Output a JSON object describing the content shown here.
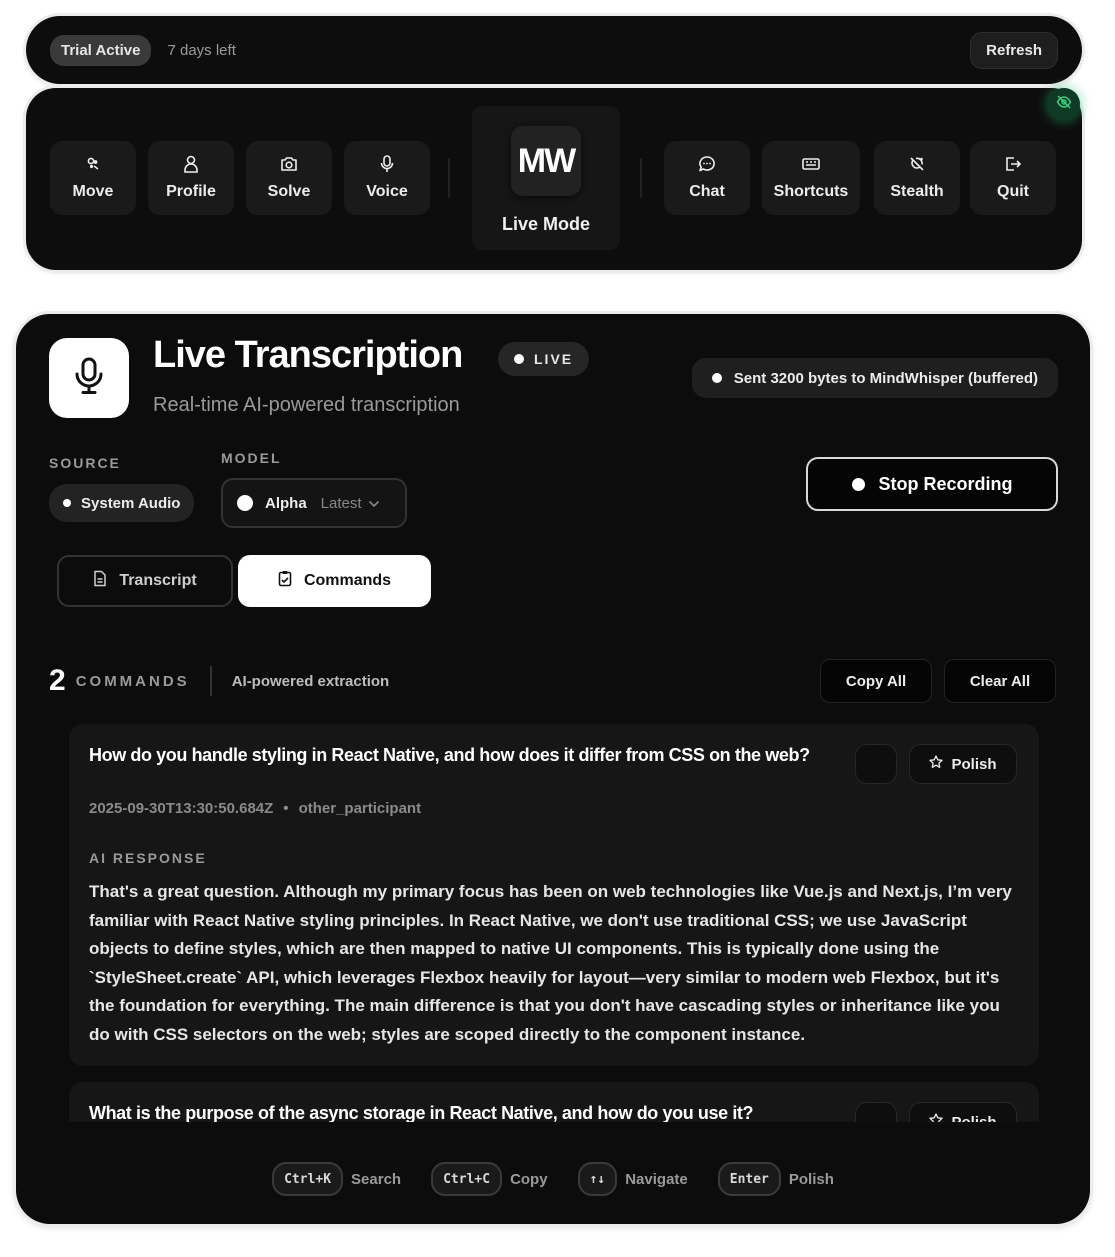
{
  "trial_bar": {
    "status_label": "Trial Active",
    "days_left": "7 days left",
    "refresh_label": "Refresh"
  },
  "toolbar": {
    "left_items": [
      {
        "label": "Move",
        "icon": "move-icon"
      },
      {
        "label": "Profile",
        "icon": "user-icon"
      },
      {
        "label": "Solve",
        "icon": "camera-icon"
      },
      {
        "label": "Voice",
        "icon": "microphone-icon"
      }
    ],
    "live_mode": {
      "logo_text": "MW",
      "label": "Live Mode"
    },
    "right_items": [
      {
        "label": "Chat",
        "icon": "chat-icon"
      },
      {
        "label": "Shortcuts",
        "icon": "keyboard-icon"
      },
      {
        "label": "Stealth",
        "icon": "stealth-icon"
      },
      {
        "label": "Quit",
        "icon": "logout-icon"
      }
    ],
    "stealth_indicator_icon": "eye-off-icon"
  },
  "panel": {
    "title": "Live Transcription",
    "live_badge": "LIVE",
    "subtitle": "Real-time AI-powered transcription",
    "status": "Sent 3200 bytes to MindWhisper (buffered)",
    "source": {
      "label": "SOURCE",
      "value": "System Audio"
    },
    "model": {
      "label": "MODEL",
      "name": "Alpha",
      "tag": "Latest"
    },
    "stop_button": "Stop Recording",
    "tabs": [
      {
        "label": "Transcript",
        "icon": "document-icon",
        "active": false
      },
      {
        "label": "Commands",
        "icon": "clipboard-icon",
        "active": true
      }
    ],
    "commands_header": {
      "count": "2",
      "word": "COMMANDS",
      "description": "AI-powered extraction",
      "copy_all": "Copy All",
      "clear_all": "Clear All"
    },
    "commands": [
      {
        "question": "How do you handle styling in React Native, and how does it differ from CSS on the web?",
        "timestamp": "2025-09-30T13:30:50.684Z",
        "separator": "•",
        "speaker": "other_participant",
        "ai_label": "AI RESPONSE",
        "response": "That's a great question. Although my primary focus has been on web technologies like Vue.js and Next.js, I’m very familiar with React Native styling principles. In React Native, we don't use traditional CSS; we use JavaScript objects to define styles, which are then mapped to native UI components. This is typically done using the `StyleSheet.create` API, which leverages Flexbox heavily for layout—very similar to modern web Flexbox, but it's the foundation for everything. The main difference is that you don't have cascading styles or inheritance like you do with CSS selectors on the web; styles are scoped directly to the component instance.",
        "polish_label": "Polish"
      },
      {
        "question": "What is the purpose of the async storage in React Native, and how do you use it?",
        "polish_label": "Polish"
      }
    ],
    "shortcuts": [
      {
        "key": "Ctrl+K",
        "label": "Search"
      },
      {
        "key": "Ctrl+C",
        "label": "Copy"
      },
      {
        "key": "↑↓",
        "label": "Navigate"
      },
      {
        "key": "Enter",
        "label": "Polish"
      }
    ]
  },
  "colors": {
    "background": "#0c0c0c",
    "card": "#161616",
    "accent_green": "#2ecc71",
    "frame": "#ececec"
  }
}
